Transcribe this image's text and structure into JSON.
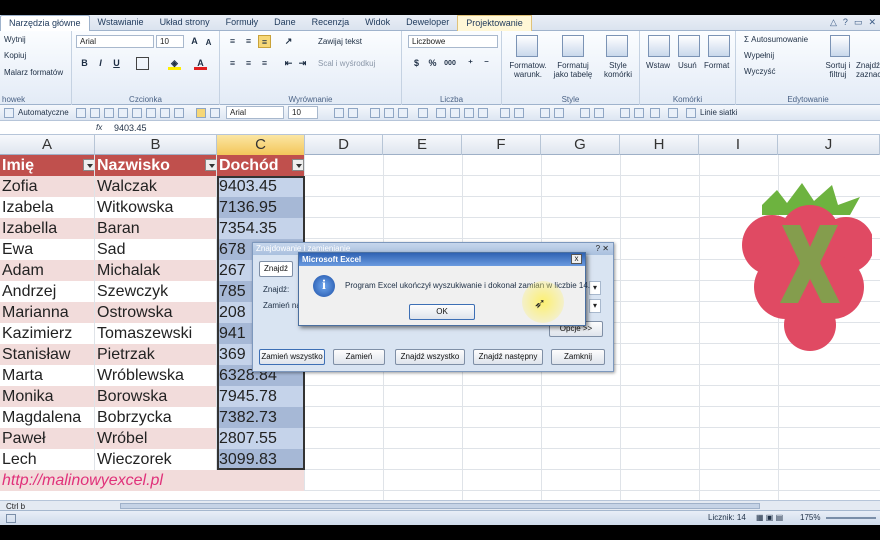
{
  "ribbon": {
    "tabs": [
      "Narzędzia główne",
      "Wstawianie",
      "Układ strony",
      "Formuły",
      "Dane",
      "Recenzja",
      "Widok",
      "Deweloper",
      "Projektowanie"
    ],
    "clipboard": {
      "cut": "Wytnij",
      "copy": "Kopiuj",
      "painter": "Malarz formatów",
      "label": "howek"
    },
    "font": {
      "name": "Arial",
      "size": "10",
      "label": "Czcionka"
    },
    "alignment": {
      "wrap": "Zawijaj tekst",
      "merge": "Scal i wyśrodkuj",
      "label": "Wyrównanie"
    },
    "number": {
      "format": "Liczbowe",
      "label": "Liczba"
    },
    "styles": {
      "cond": "Formatow. warunk.",
      "table": "Formatuj jako tabelę",
      "cell": "Style komórki",
      "label": "Style"
    },
    "cells": {
      "insert": "Wstaw",
      "delete": "Usuń",
      "format": "Format",
      "label": "Komórki"
    },
    "editing": {
      "autosum": "Autosumowanie",
      "fill": "Wypełnij",
      "clear": "Wyczyść",
      "sort": "Sortuj i filtruj",
      "find": "Znajdź i zaznacz",
      "label": "Edytowanie"
    }
  },
  "qat": {
    "auto": "Automatyczne",
    "font": "Arial",
    "size": "10",
    "gridlines": "Linie siatki"
  },
  "formula": {
    "fx": "fx",
    "value": "9403.45"
  },
  "columns": [
    "A",
    "B",
    "C",
    "D",
    "E",
    "F",
    "G",
    "H",
    "I",
    "J"
  ],
  "table": {
    "headers": [
      "Imię",
      "Nazwisko",
      "Dochód"
    ],
    "rows": [
      [
        "Zofia",
        "Walczak",
        "9403.45"
      ],
      [
        "Izabela",
        "Witkowska",
        "7136.95"
      ],
      [
        "Izabella",
        "Baran",
        "7354.35"
      ],
      [
        "Ewa",
        "Sad",
        "678"
      ],
      [
        "Adam",
        "Michalak",
        "267"
      ],
      [
        "Andrzej",
        "Szewczyk",
        "785"
      ],
      [
        "Marianna",
        "Ostrowska",
        "208"
      ],
      [
        "Kazimierz",
        "Tomaszewski",
        "941"
      ],
      [
        "Stanisław",
        "Pietrzak",
        "369"
      ],
      [
        "Marta",
        "Wróblewska",
        "6328.84"
      ],
      [
        "Monika",
        "Borowska",
        "7945.78"
      ],
      [
        "Magdalena",
        "Bobrzycka",
        "7382.73"
      ],
      [
        "Paweł",
        "Wróbel",
        "2807.55"
      ],
      [
        "Lech",
        "Wieczorek",
        "3099.83"
      ]
    ],
    "link": "http://malinowyexcel.pl"
  },
  "find_dialog": {
    "title": "Znajdowanie i zamienianie",
    "tab": "Znajdź",
    "find_label": "Znajdź:",
    "replace_label": "Zamień na:",
    "options": "Opcje >>",
    "buttons": [
      "Zamień wszystko",
      "Zamień",
      "Znajdź wszystko",
      "Znajdź następny",
      "Zamknij"
    ]
  },
  "message": {
    "title": "Microsoft Excel",
    "text": "Program Excel ukończył wyszukiwanie i dokonał zamian w liczbie 14.",
    "ok": "OK",
    "close": "x"
  },
  "status": {
    "mode": "Ctrl b",
    "count": "Licznik: 14",
    "zoom": "175%"
  }
}
